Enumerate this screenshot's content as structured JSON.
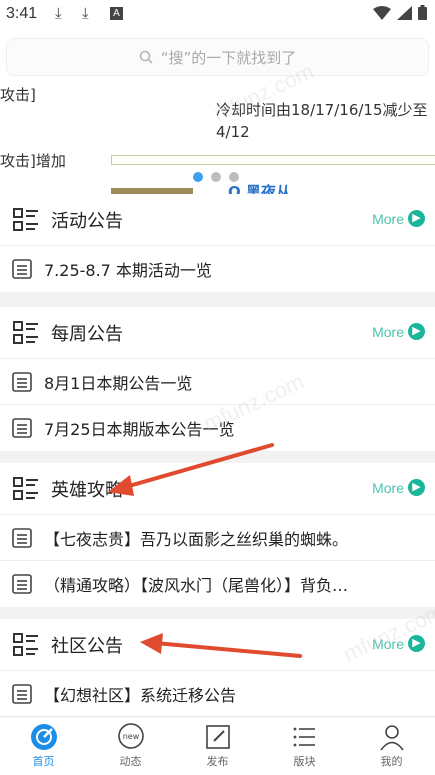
{
  "status": {
    "time": "3:41",
    "notif_a": "A"
  },
  "search": {
    "placeholder": "“搜”的一下就找到了"
  },
  "banner": {
    "line1": "攻击]",
    "line2": "冷却时间由18/17/16/15减少至",
    "line3": "4/12",
    "line4": "攻击]增加",
    "line5": "Q 黑夜从"
  },
  "sections": [
    {
      "title": "活动公告",
      "more": "More",
      "items": [
        "7.25-8.7 本期活动一览"
      ]
    },
    {
      "title": "每周公告",
      "more": "More",
      "items": [
        "8月1日本期公告一览",
        "7月25日本期版本公告一览"
      ]
    },
    {
      "title": "英雄攻略",
      "more": "More",
      "items": [
        "【七夜志贵】吾乃以面影之丝织巢的蜘蛛。",
        "（精通攻略）【波风水门（尾兽化）】背负…"
      ]
    },
    {
      "title": "社区公告",
      "more": "More",
      "items": [
        "【幻想社区】系统迁移公告"
      ]
    }
  ],
  "tabs": [
    {
      "label": "首页",
      "icon": "home-compass-icon",
      "active": true
    },
    {
      "label": "动态",
      "icon": "new-bubble-icon",
      "badge": "new"
    },
    {
      "label": "发布",
      "icon": "edit-icon"
    },
    {
      "label": "版块",
      "icon": "list-icon"
    },
    {
      "label": "我的",
      "icon": "user-icon"
    }
  ],
  "watermark": "mfunz.com",
  "colors": {
    "accent": "#1bb59c",
    "more_text": "#4ac5ad",
    "tab_active": "#1c8ee8",
    "annotation": "#e04a2f"
  }
}
